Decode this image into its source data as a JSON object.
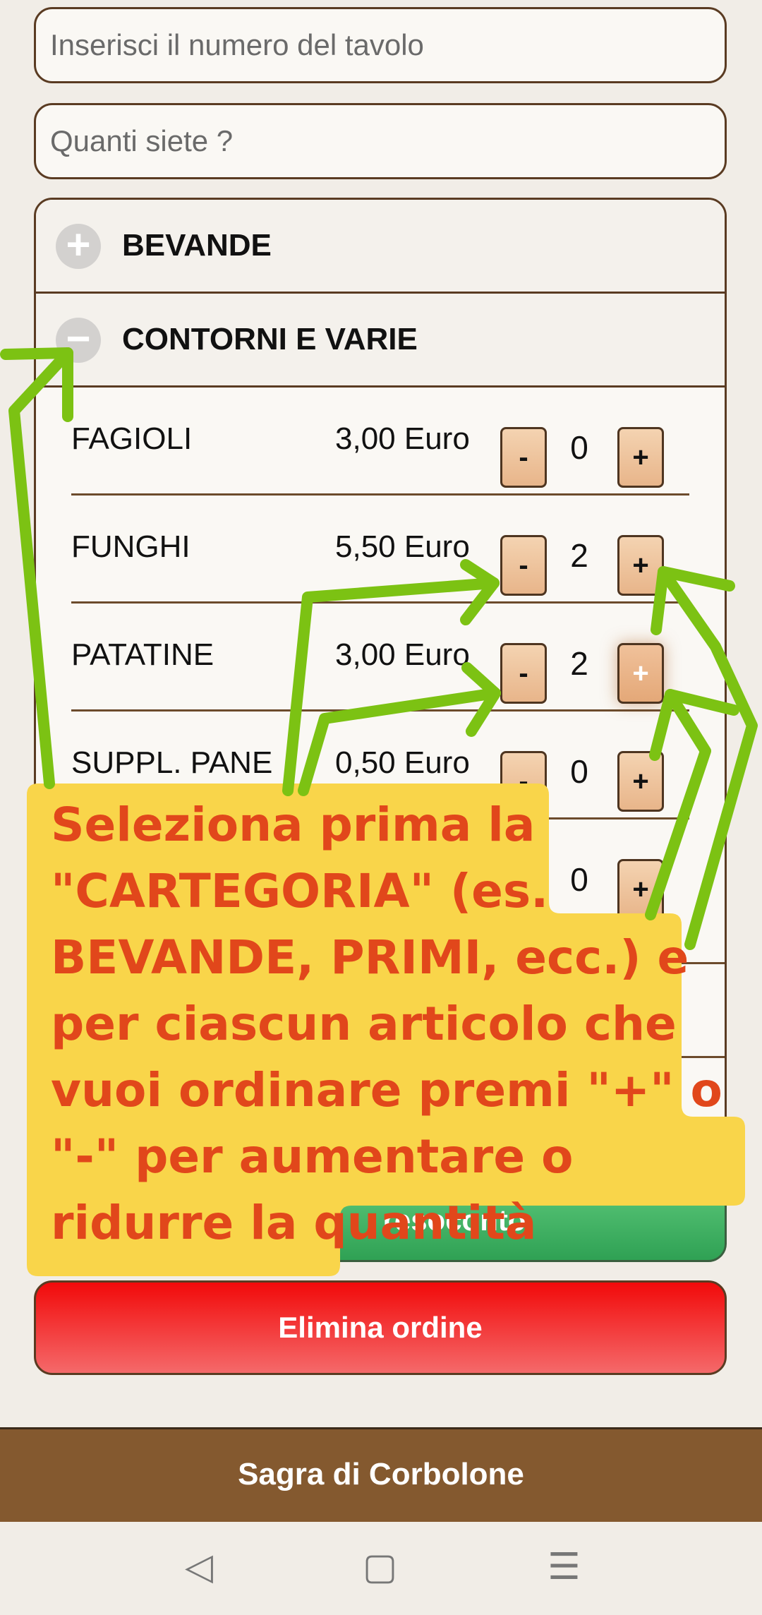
{
  "form": {
    "table_placeholder": "Inserisci il numero del tavolo",
    "guests_placeholder": "Quanti siete ?"
  },
  "categories": [
    {
      "label": "BEVANDE",
      "icon": "plus-circle-icon",
      "expanded": false
    },
    {
      "label": "CONTORNI E VARIE",
      "icon": "minus-circle-icon",
      "expanded": true
    }
  ],
  "items": [
    {
      "name": "FAGIOLI",
      "price": "3,00 Euro",
      "qty": "0"
    },
    {
      "name": "FUNGHI",
      "price": "5,50 Euro",
      "qty": "2"
    },
    {
      "name": "PATATINE",
      "price": "3,00 Euro",
      "qty": "2"
    },
    {
      "name": "SUPPL. PANE",
      "price": "0,50 Euro",
      "qty": "0"
    },
    {
      "name": "",
      "price": "",
      "qty": "0"
    }
  ],
  "controls": {
    "minus": "-",
    "plus": "+"
  },
  "buttons": {
    "summary": "resoconto",
    "delete": "Elimina ordine"
  },
  "footer": {
    "title": "Sagra di Corbolone"
  },
  "navbar": {
    "back": "◁",
    "home": "▢",
    "menu": "☰"
  },
  "callout": {
    "text": "Seleziona prima la \"CARTEGORIA\" (es. BEVANDE, PRIMI, ecc.) e per ciascun articolo che vuoi ordinare premi \"+\" o \"-\" per aumentare o ridurre la quantità",
    "text_color": "#e1471b",
    "background": "#f9d54a",
    "arrow_color": "#7cc213"
  }
}
